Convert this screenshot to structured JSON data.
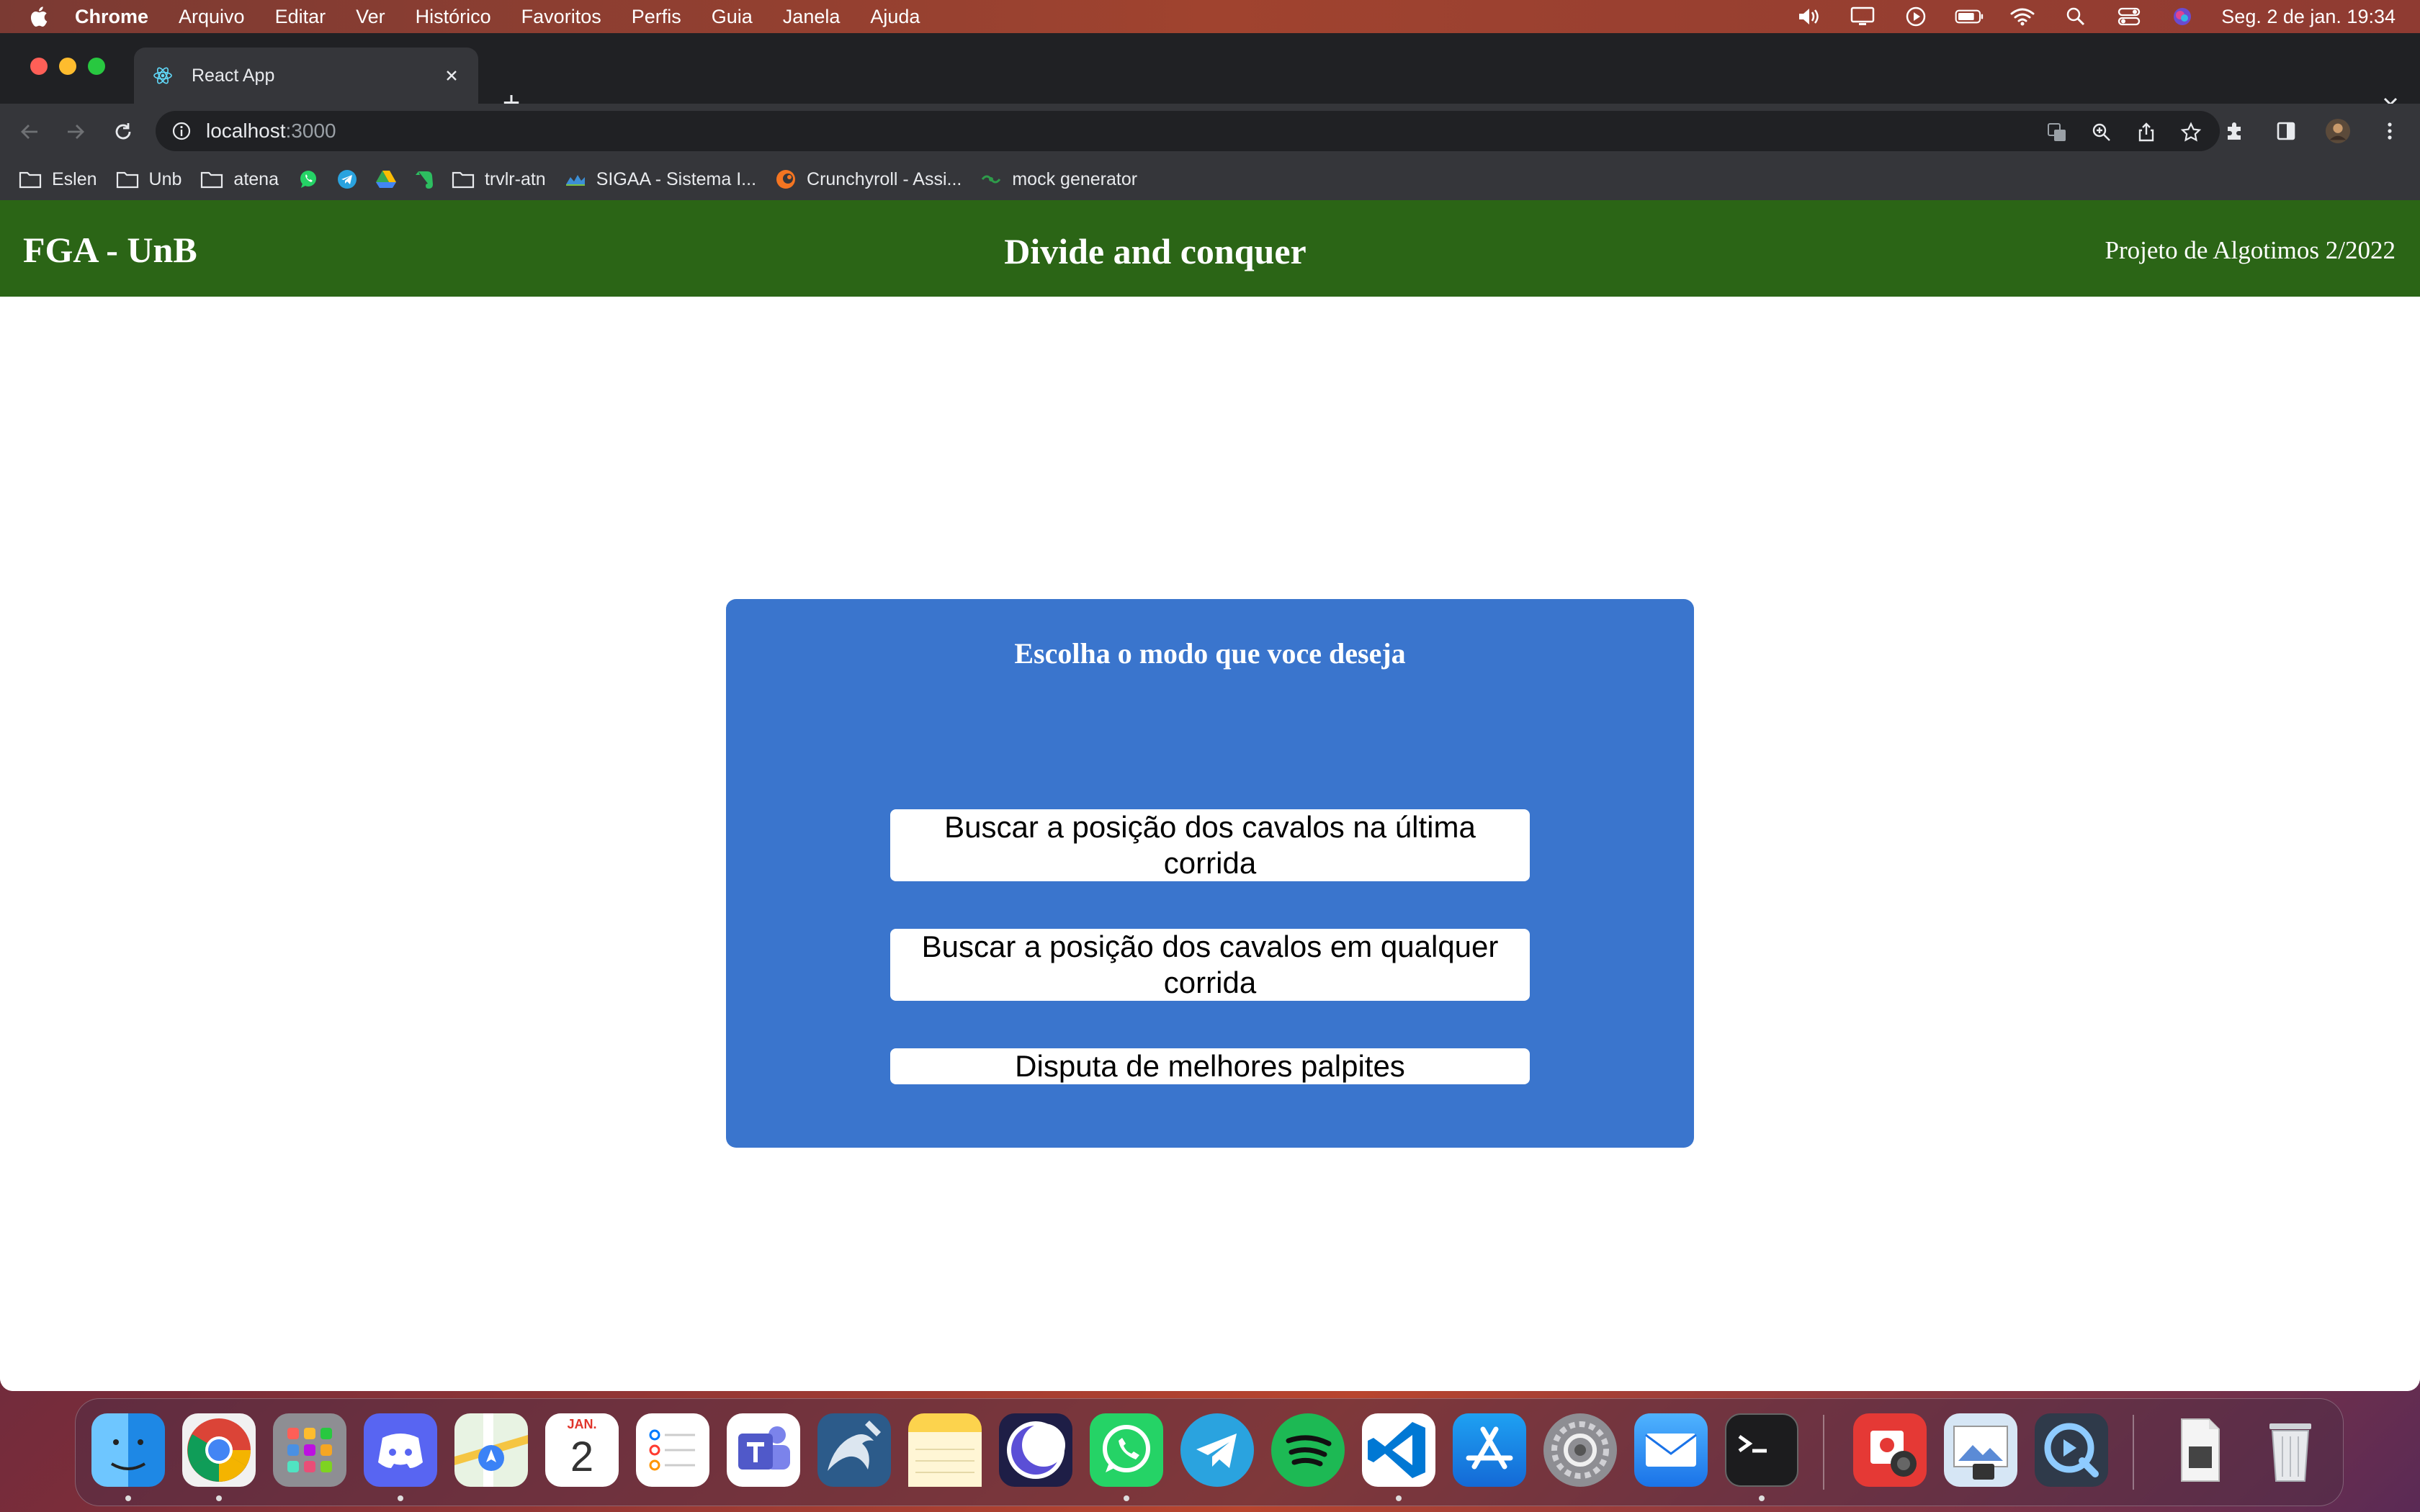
{
  "menubar": {
    "app_name": "Chrome",
    "items": [
      "Arquivo",
      "Editar",
      "Ver",
      "Histórico",
      "Favoritos",
      "Perfis",
      "Guia",
      "Janela",
      "Ajuda"
    ],
    "datetime": "Seg. 2 de jan.  19:34",
    "status_icons": [
      "volume-icon",
      "display-icon",
      "play-icon",
      "battery-icon",
      "wifi-icon",
      "spotlight-icon",
      "control-center-icon",
      "siri-icon"
    ]
  },
  "browser": {
    "tab_title": "React App",
    "url_host": "localhost",
    "url_port": ":3000",
    "bookmarks": [
      {
        "label": "Eslen",
        "icon": "folder-icon"
      },
      {
        "label": "Unb",
        "icon": "folder-icon"
      },
      {
        "label": "atena",
        "icon": "folder-icon"
      },
      {
        "label": "",
        "icon": "whatsapp-icon"
      },
      {
        "label": "",
        "icon": "telegram-icon"
      },
      {
        "label": "",
        "icon": "google-drive-icon"
      },
      {
        "label": "",
        "icon": "evernote-icon"
      },
      {
        "label": "trvlr-atn",
        "icon": "folder-icon"
      },
      {
        "label": "SIGAA - Sistema I...",
        "icon": "sigaa-icon"
      },
      {
        "label": "Crunchyroll - Assi...",
        "icon": "crunchyroll-icon"
      },
      {
        "label": "mock generator",
        "icon": "mock-icon"
      }
    ]
  },
  "header": {
    "left": "FGA - UnB",
    "center": "Divide and conquer",
    "right": "Projeto de Algotimos 2/2022"
  },
  "card": {
    "heading": "Escolha o modo que voce deseja",
    "buttons": [
      "Buscar a posição dos cavalos na última corrida",
      "Buscar a posição dos cavalos em qualquer corrida",
      "Disputa de melhores palpites"
    ]
  },
  "dock": {
    "calendar_month": "JAN.",
    "calendar_day": "2"
  },
  "colors": {
    "header_bg": "#2b6516",
    "card_bg": "#3a75cd",
    "tab_bg": "#35363a",
    "tabstrip_bg": "#202124"
  }
}
